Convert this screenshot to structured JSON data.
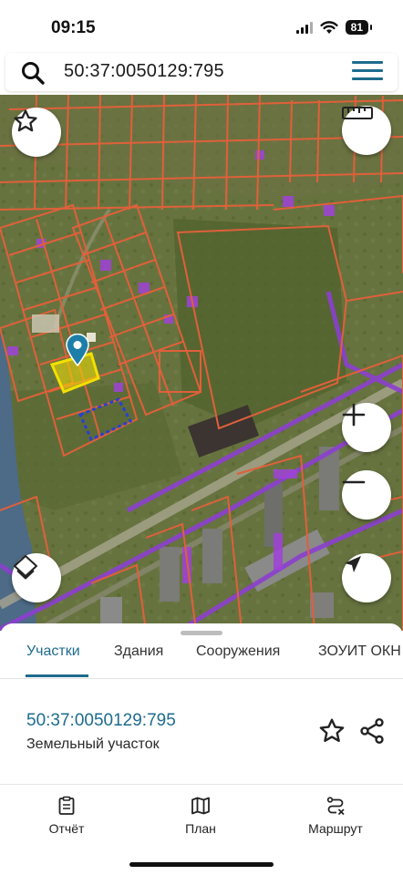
{
  "status_bar": {
    "time": "09:15",
    "battery": "81"
  },
  "search": {
    "query": "50:37:0050129:795"
  },
  "tabs": [
    {
      "label": "Участки",
      "active": true
    },
    {
      "label": "Здания",
      "active": false
    },
    {
      "label": "Сооружения",
      "active": false
    },
    {
      "label": "ЗОУИТ ОКН",
      "active": false
    }
  ],
  "parcel": {
    "number": "50:37:0050129:795",
    "type": "Земельный участок"
  },
  "bottom_nav": [
    {
      "label": "Отчёт",
      "icon": "report-icon"
    },
    {
      "label": "План",
      "icon": "map-icon"
    },
    {
      "label": "Маршрут",
      "icon": "route-icon"
    }
  ],
  "colors": {
    "accent": "#1d6c8e",
    "parcel_border": "#e0603a",
    "zone_border": "#8c3fd0",
    "selected_fill": "#f4e000"
  }
}
